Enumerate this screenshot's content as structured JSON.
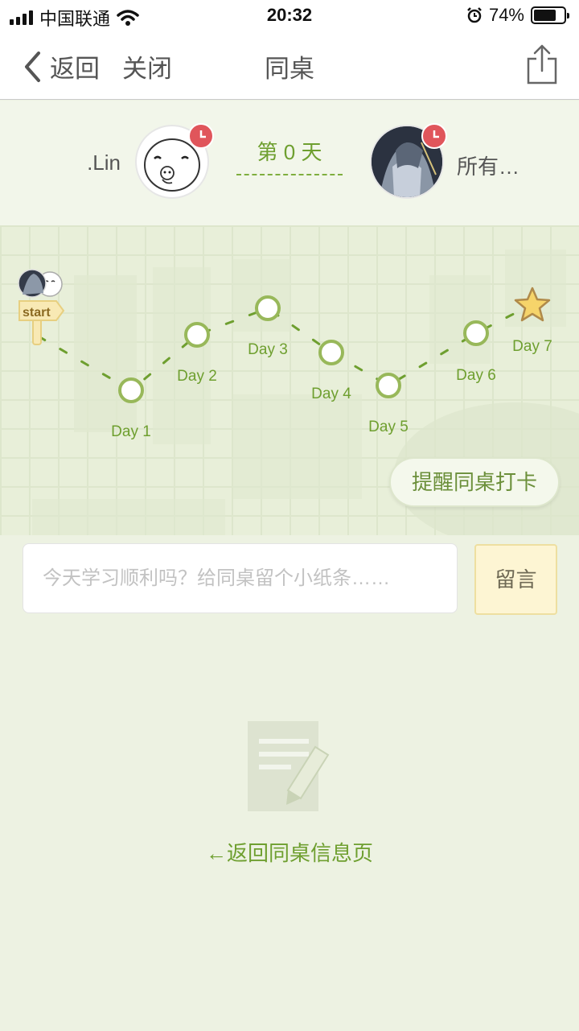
{
  "status_bar": {
    "carrier": "中国联通",
    "time": "20:32",
    "battery": "74%",
    "battery_level": 0.74
  },
  "nav": {
    "back_label": "返回",
    "close_label": "关闭",
    "title": "同桌"
  },
  "pair": {
    "left_name": ".Lin",
    "right_name": "所有…",
    "day_count": "第 0 天"
  },
  "journey": {
    "start_label": "start",
    "days": [
      "Day 1",
      "Day 2",
      "Day 3",
      "Day 4",
      "Day 5",
      "Day 6",
      "Day 7"
    ]
  },
  "remind_button": "提醒同桌打卡",
  "message": {
    "placeholder": "今天学习顺利吗？给同桌留个小纸条……",
    "send_label": "留言"
  },
  "empty_state": {
    "back_link": "←返回同桌信息页"
  },
  "colors": {
    "accent": "#6e9f2f",
    "badge": "#e0555b"
  }
}
